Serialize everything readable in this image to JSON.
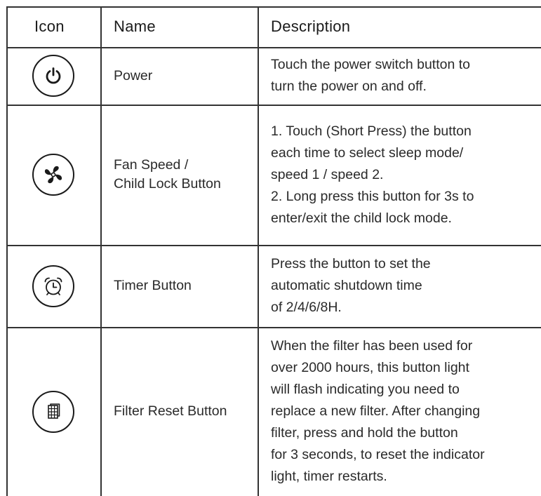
{
  "headers": {
    "icon": "Icon",
    "name": "Name",
    "description": "Description"
  },
  "rows": [
    {
      "icon": "power-icon",
      "name_lines": [
        "Power"
      ],
      "description_lines": [
        "Touch the power switch button to",
        "turn the power on and off."
      ]
    },
    {
      "icon": "fan-icon",
      "name_lines": [
        "Fan Speed /",
        "Child Lock Button"
      ],
      "description_lines": [
        "1.  Touch (Short Press) the button",
        "each time to select sleep mode/",
        "speed 1 / speed 2.",
        "2. Long press this button for 3s to",
        "enter/exit the child lock mode."
      ]
    },
    {
      "icon": "alarm-clock-icon",
      "name_lines": [
        "Timer Button"
      ],
      "description_lines": [
        "Press the button to set the",
        "automatic shutdown time",
        "of 2/4/6/8H."
      ]
    },
    {
      "icon": "filter-icon",
      "name_lines": [
        "Filter Reset Button"
      ],
      "description_lines": [
        "When the filter has been used for",
        "over 2000 hours, this button light",
        "will flash indicating you need to",
        "replace a new filter.  After changing",
        "filter, press and hold the button",
        "for 3 seconds, to reset the indicator",
        "light, timer restarts."
      ]
    }
  ]
}
